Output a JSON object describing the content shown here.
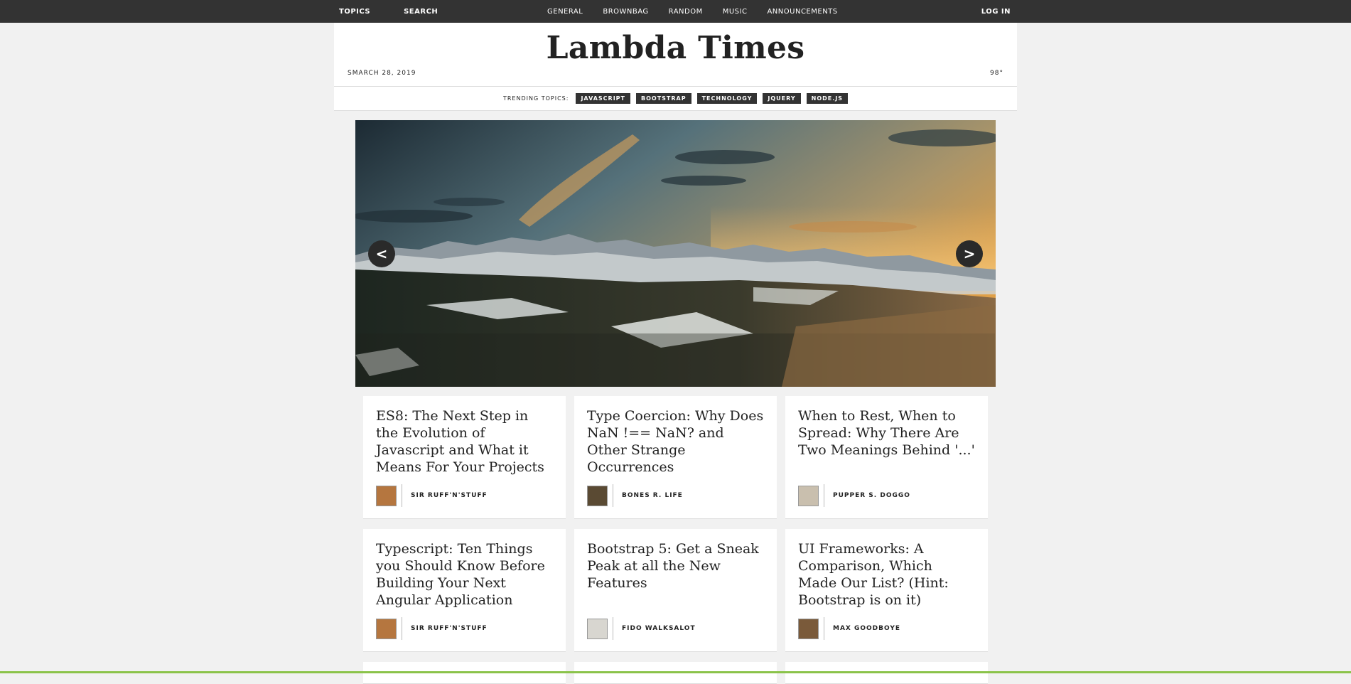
{
  "topbar": {
    "left": [
      {
        "label": "TOPICS"
      },
      {
        "label": "SEARCH"
      }
    ],
    "center": [
      {
        "label": "GENERAL"
      },
      {
        "label": "BROWNBAG"
      },
      {
        "label": "RANDOM"
      },
      {
        "label": "MUSIC"
      },
      {
        "label": "ANNOUNCEMENTS"
      }
    ],
    "login": "LOG IN"
  },
  "header": {
    "title": "Lambda Times",
    "date": "SMARCH 28, 2019",
    "temp": "98°"
  },
  "trending": {
    "label": "TRENDING TOPICS:",
    "tags": [
      "JAVASCRIPT",
      "BOOTSTRAP",
      "TECHNOLOGY",
      "JQUERY",
      "NODE.JS"
    ]
  },
  "carousel": {
    "prev": "<",
    "next": ">"
  },
  "cards": [
    {
      "headline": "ES8: The Next Step in the Evolution of Javascript and What it Means For Your Projects",
      "author": "SIR RUFF'N'STUFF",
      "avatar_color": "#b5763f"
    },
    {
      "headline": "Type Coercion: Why Does NaN !== NaN? and Other Strange Occurrences",
      "author": "BONES R. LIFE",
      "avatar_color": "#5a4a33"
    },
    {
      "headline": "When to Rest, When to Spread: Why There Are Two Meanings Behind '...'",
      "author": "PUPPER S. DOGGO",
      "avatar_color": "#c9bfae"
    },
    {
      "headline": "Typescript: Ten Things you Should Know Before Building Your Next Angular Application",
      "author": "SIR RUFF'N'STUFF",
      "avatar_color": "#b5763f"
    },
    {
      "headline": "Bootstrap 5: Get a Sneak Peak at all the New Features",
      "author": "FIDO WALKSALOT",
      "avatar_color": "#d8d6d0"
    },
    {
      "headline": "UI Frameworks: A Comparison, Which Made Our List? (Hint: Bootstrap is on it)",
      "author": "MAX GOODBOYE",
      "avatar_color": "#7a5a3a"
    }
  ],
  "colors": {
    "topbar": "#333333",
    "accent_line": "#8bc34a",
    "tag_bg": "#333333"
  }
}
